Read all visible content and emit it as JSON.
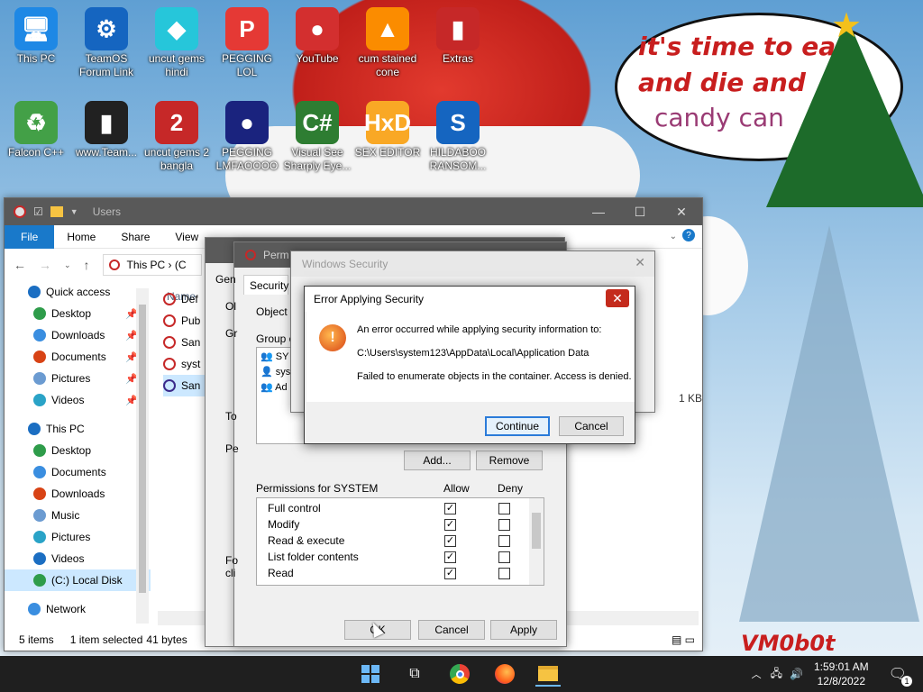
{
  "wallpaper": {
    "bubble_line1": "it's time to eat",
    "bubble_line1b": "it",
    "bubble_line2": "and die and",
    "bubble_line3": "candy can",
    "signature": "VM0b0t"
  },
  "desktop_icons": [
    {
      "label": "This PC",
      "icon": "monitor-icon",
      "color": "#1e88e5"
    },
    {
      "label": "TeamOS Forum Link",
      "icon": "gear-icon",
      "color": "#1565c0"
    },
    {
      "label": "uncut gems hindi",
      "icon": "gem-icon",
      "color": "#26c6da"
    },
    {
      "label": "PEGGING LOL",
      "icon": "p-logo-icon",
      "color": "#e53935"
    },
    {
      "label": "YouTube",
      "icon": "angry-bird-icon",
      "color": "#d32f2f"
    },
    {
      "label": "cum stained cone",
      "icon": "traffic-cone-icon",
      "color": "#fb8c00"
    },
    {
      "label": "Extras",
      "icon": "folder-red-icon",
      "color": "#c62828"
    },
    {
      "label": "Falcon C++",
      "icon": "recycle-icon",
      "color": "#43a047"
    },
    {
      "label": "www.Team...",
      "icon": "book-icon",
      "color": "#212121"
    },
    {
      "label": "uncut gems 2 bangla",
      "icon": "number-2-icon",
      "color": "#c62828"
    },
    {
      "label": "PEGGING LMFAOOOO",
      "icon": "ornament-icon",
      "color": "#1a237e"
    },
    {
      "label": "Visual See Sharply Eye...",
      "icon": "csharp-icon",
      "color": "#2e7d32"
    },
    {
      "label": "SEX EDITOR",
      "icon": "hxd-icon",
      "color": "#f9a825"
    },
    {
      "label": "HILDABOO RANSOM...",
      "icon": "script-icon",
      "color": "#1565c0"
    }
  ],
  "explorer": {
    "title": "Users",
    "ribbon_tabs": [
      "File",
      "Home",
      "Share",
      "View"
    ],
    "address": "This PC  ›  (C",
    "nav": [
      {
        "label": "Quick access",
        "pinned": false,
        "level": 0
      },
      {
        "label": "Desktop",
        "pinned": true,
        "level": 1
      },
      {
        "label": "Downloads",
        "pinned": true,
        "level": 1
      },
      {
        "label": "Documents",
        "pinned": true,
        "level": 1
      },
      {
        "label": "Pictures",
        "pinned": true,
        "level": 1
      },
      {
        "label": "Videos",
        "pinned": true,
        "level": 1
      },
      {
        "label": "This PC",
        "pinned": false,
        "level": 0
      },
      {
        "label": "Desktop",
        "pinned": false,
        "level": 1
      },
      {
        "label": "Documents",
        "pinned": false,
        "level": 1
      },
      {
        "label": "Downloads",
        "pinned": false,
        "level": 1
      },
      {
        "label": "Music",
        "pinned": false,
        "level": 1
      },
      {
        "label": "Pictures",
        "pinned": false,
        "level": 1
      },
      {
        "label": "Videos",
        "pinned": false,
        "level": 1
      },
      {
        "label": "(C:) Local Disk",
        "pinned": false,
        "level": 1
      },
      {
        "label": "Network",
        "pinned": false,
        "level": 0
      }
    ],
    "column_name": "Name",
    "files": [
      "Def",
      "Pub",
      "San",
      "syst",
      "San"
    ],
    "size_col": "1 KB",
    "status": {
      "items": "5 items",
      "selected": "1 item selected",
      "size": "41 bytes"
    }
  },
  "properties": {
    "title": "Perm",
    "tabs": [
      "Gen",
      "Security"
    ],
    "object_label": "Object n",
    "group_label": "Group o",
    "group_items": [
      "SY",
      "sys",
      "Ad"
    ],
    "to_label": "To",
    "pe_label": "Pe",
    "fo_label": "Fo",
    "cli_label": "cli",
    "obj_short": "Ol",
    "grp_short": "Gr",
    "add_button": "Add...",
    "remove_button": "Remove",
    "perm_header": "Permissions for SYSTEM",
    "allow_header": "Allow",
    "deny_header": "Deny",
    "permissions": [
      {
        "name": "Full control",
        "allow": true,
        "deny": false
      },
      {
        "name": "Modify",
        "allow": true,
        "deny": false
      },
      {
        "name": "Read & execute",
        "allow": true,
        "deny": false
      },
      {
        "name": "List folder contents",
        "allow": true,
        "deny": false
      },
      {
        "name": "Read",
        "allow": true,
        "deny": false
      }
    ],
    "ok_button": "OK",
    "cancel_button": "Cancel",
    "apply_button": "Apply"
  },
  "windows_security": {
    "title": "Windows Security"
  },
  "error_dialog": {
    "title": "Error Applying Security",
    "line1": "An error occurred while applying security information to:",
    "path": "C:\\Users\\system123\\AppData\\Local\\Application Data",
    "line3": "Failed to enumerate objects in the container. Access is denied.",
    "continue_button": "Continue",
    "cancel_button": "Cancel"
  },
  "taskbar": {
    "time": "1:59:01 AM",
    "date": "12/8/2022",
    "notification_count": "1"
  }
}
